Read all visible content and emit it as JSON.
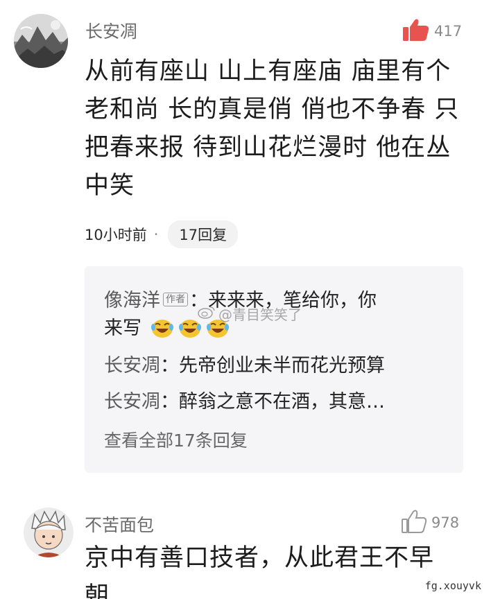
{
  "comments": [
    {
      "username": "长安凋",
      "likes": "417",
      "like_icon": "thumbs-up-filled-icon",
      "body_lines": [
        "从前有座山 山上有座庙 庙里有个",
        "老和尚 长的真是俏 俏也不争春 只",
        "把春来报 待到山花烂漫时 他在丛",
        "中笑"
      ],
      "time": "10小时前",
      "dot": "·",
      "reply_count_label": "17回复"
    },
    {
      "username": "不苦面包",
      "likes": "978",
      "like_icon": "thumbs-up-outline-icon",
      "body_lines": [
        "京中有善口技者，从此君王不早",
        "朝"
      ]
    }
  ],
  "replies": {
    "first": {
      "name": "像海洋",
      "author_tag": "作者",
      "line1": "：来来来，笔给你，你",
      "line2": "来写",
      "emoji": "laughing-cry-emoji"
    },
    "second": {
      "name": "长安凋",
      "text": "：先帝创业未半而花光预算"
    },
    "third": {
      "name": "长安凋",
      "text": "：醉翁之意不在酒，其意…"
    },
    "view_all": "查看全部17条回复"
  },
  "watermark": {
    "text": "@青目笑笑了"
  },
  "corner_mark": "fg.xouyvk",
  "colors": {
    "like_active": "#e8534f",
    "like_inactive": "#9a9a9a",
    "reply_bg": "#f5f5f7"
  }
}
